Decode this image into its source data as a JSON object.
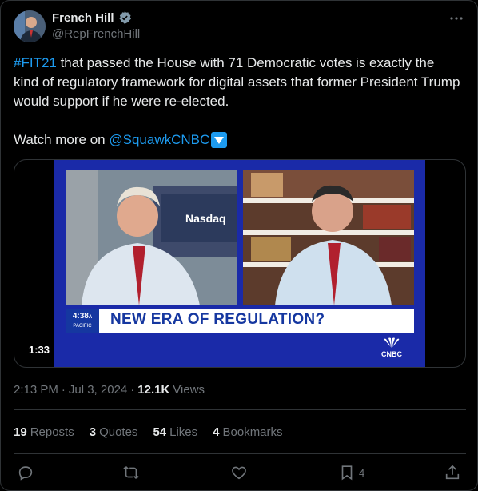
{
  "author": {
    "name": "French Hill",
    "handle": "@RepFrenchHill"
  },
  "tweet": {
    "hashtag": "#FIT21",
    "body": " that passed the House with 71 Democratic votes is exactly the kind of regulatory framework for digital assets that former President Trump would support if he were re-elected.",
    "watch_prefix": "Watch more on ",
    "mention": "@SquawkCNBC"
  },
  "media": {
    "duration": "1:33",
    "chyron_time": "4:38",
    "chyron_zone_suffix": "A",
    "chyron_zone": "PACIFIC",
    "headline": "NEW ERA OF REGULATION?",
    "network": "CNBC",
    "wall_sign": "Nasdaq"
  },
  "meta": {
    "time": "2:13 PM",
    "separator": "·",
    "date": "Jul 3, 2024",
    "views_count": "12.1K",
    "views_label": "Views"
  },
  "stats": [
    {
      "count": "19",
      "label": "Reposts"
    },
    {
      "count": "3",
      "label": "Quotes"
    },
    {
      "count": "54",
      "label": "Likes"
    },
    {
      "count": "4",
      "label": "Bookmarks"
    }
  ],
  "actions": {
    "bookmark_count": "4"
  },
  "colors": {
    "accent": "#1d9bf0",
    "background": "#000000",
    "muted": "#71767b",
    "chyron_blue": "#1537a0"
  }
}
